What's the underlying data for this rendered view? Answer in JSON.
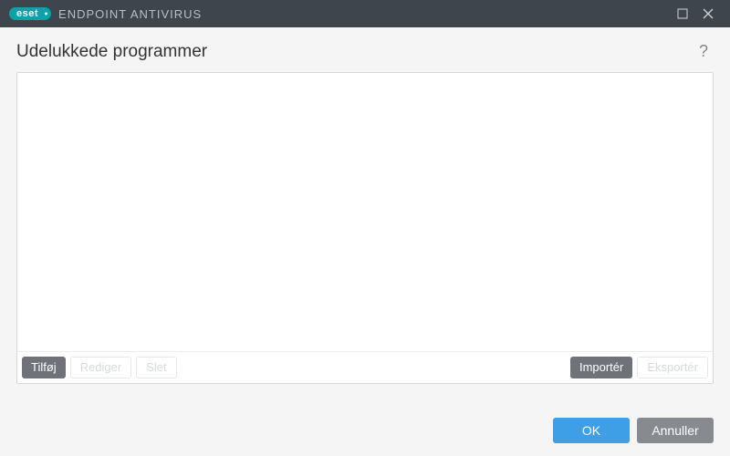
{
  "titlebar": {
    "logo_text": "eset",
    "product_name": "ENDPOINT ANTIVIRUS"
  },
  "page": {
    "title": "Udelukkede programmer"
  },
  "toolbar": {
    "add_label": "Tilføj",
    "edit_label": "Rediger",
    "delete_label": "Slet",
    "import_label": "Importér",
    "export_label": "Eksportér"
  },
  "footer": {
    "ok_label": "OK",
    "cancel_label": "Annuller"
  }
}
